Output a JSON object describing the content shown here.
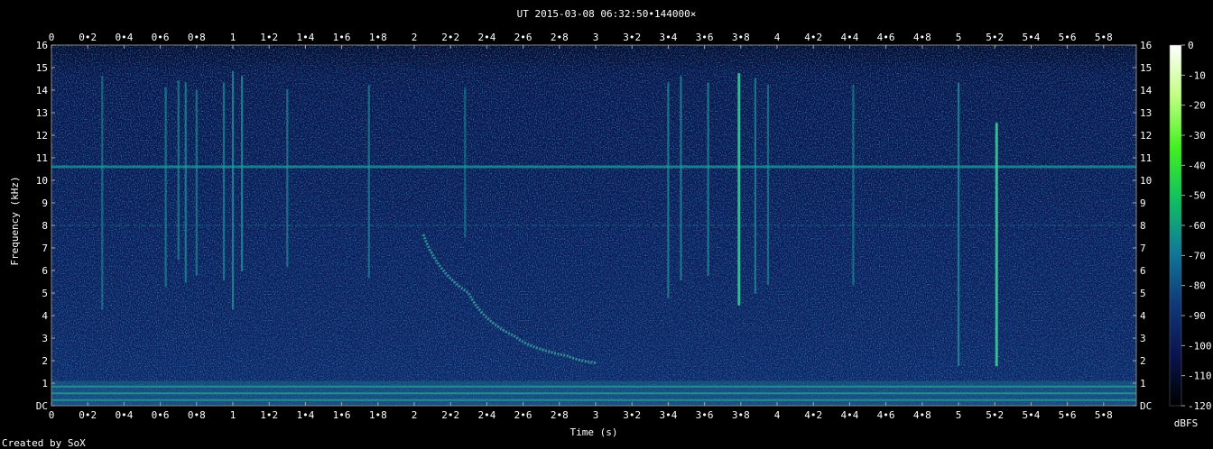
{
  "chart_data": {
    "type": "heatmap",
    "title": "UT 2015-03-08 06:32:50•144000×",
    "xlabel": "Time (s)",
    "ylabel": "Frequency (kHz)",
    "xlim": [
      0,
      5.98
    ],
    "ylim": [
      0,
      16
    ],
    "x_ticks": [
      "0",
      "0•2",
      "0•4",
      "0•6",
      "0•8",
      "1",
      "1•2",
      "1•4",
      "1•6",
      "1•8",
      "2",
      "2•2",
      "2•4",
      "2•6",
      "2•8",
      "3",
      "3•2",
      "3•4",
      "3•6",
      "3•8",
      "4",
      "4•2",
      "4•4",
      "4•6",
      "4•8",
      "5",
      "5•2",
      "5•4",
      "5•6",
      "5•8"
    ],
    "y_ticks": [
      "DC",
      "1",
      "2",
      "3",
      "4",
      "5",
      "6",
      "7",
      "8",
      "9",
      "10",
      "11",
      "12",
      "13",
      "14",
      "15",
      "16"
    ],
    "colorbar": {
      "label": "dBFS",
      "range": [
        -120,
        0
      ],
      "ticks": [
        "0",
        "-10",
        "-20",
        "-30",
        "-40",
        "-50",
        "-60",
        "-70",
        "-80",
        "-90",
        "-100",
        "-110",
        "-120"
      ],
      "colors": [
        "#000000",
        "#0a1450",
        "#103a7a",
        "#107a9a",
        "#10c060",
        "#40f020",
        "#c0ff80",
        "#ffffff"
      ]
    },
    "features": {
      "background_colors": [
        "#0a1a55",
        "#0d2a6a",
        "#10357a",
        "#0c2060",
        "#123f85"
      ],
      "line_color": "#1e9a9e",
      "bright_color": "#2bd08a",
      "hum_bands_khz": [
        10.6,
        8.0
      ],
      "low_band_khz": [
        0,
        1.1
      ],
      "impulses": [
        {
          "t": 0.28,
          "f": [
            4.3,
            14.6
          ],
          "level": -88
        },
        {
          "t": 0.63,
          "f": [
            5.3,
            14.1
          ],
          "level": -85
        },
        {
          "t": 0.7,
          "f": [
            6.5,
            14.4
          ],
          "level": -84
        },
        {
          "t": 0.74,
          "f": [
            5.5,
            14.3
          ],
          "level": -82
        },
        {
          "t": 0.8,
          "f": [
            5.8,
            14.0
          ],
          "level": -85
        },
        {
          "t": 0.95,
          "f": [
            5.6,
            14.3
          ],
          "level": -84
        },
        {
          "t": 1.0,
          "f": [
            4.3,
            14.8
          ],
          "level": -80
        },
        {
          "t": 1.05,
          "f": [
            6.0,
            14.6
          ],
          "level": -80
        },
        {
          "t": 1.3,
          "f": [
            6.2,
            14.0
          ],
          "level": -85
        },
        {
          "t": 1.75,
          "f": [
            5.7,
            14.2
          ],
          "level": -85
        },
        {
          "t": 2.28,
          "f": [
            7.5,
            14.1
          ],
          "level": -88
        },
        {
          "t": 3.4,
          "f": [
            4.8,
            14.3
          ],
          "level": -82
        },
        {
          "t": 3.47,
          "f": [
            5.6,
            14.6
          ],
          "level": -82
        },
        {
          "t": 3.62,
          "f": [
            5.8,
            14.3
          ],
          "level": -82
        },
        {
          "t": 3.79,
          "f": [
            4.5,
            14.7
          ],
          "level": -72
        },
        {
          "t": 3.88,
          "f": [
            5.0,
            14.5
          ],
          "level": -82
        },
        {
          "t": 3.95,
          "f": [
            5.4,
            14.2
          ],
          "level": -86
        },
        {
          "t": 4.42,
          "f": [
            5.4,
            14.2
          ],
          "level": -86
        },
        {
          "t": 5.0,
          "f": [
            1.8,
            14.3
          ],
          "level": -80
        },
        {
          "t": 5.21,
          "f": [
            1.8,
            12.5
          ],
          "level": -72
        }
      ],
      "sweep_khz_by_s": [
        [
          2.05,
          7.6
        ],
        [
          2.3,
          5.0
        ],
        [
          2.55,
          3.1
        ],
        [
          2.85,
          2.2
        ],
        [
          3.0,
          1.9
        ]
      ]
    }
  },
  "footer": {
    "credit": "Created by SoX"
  }
}
